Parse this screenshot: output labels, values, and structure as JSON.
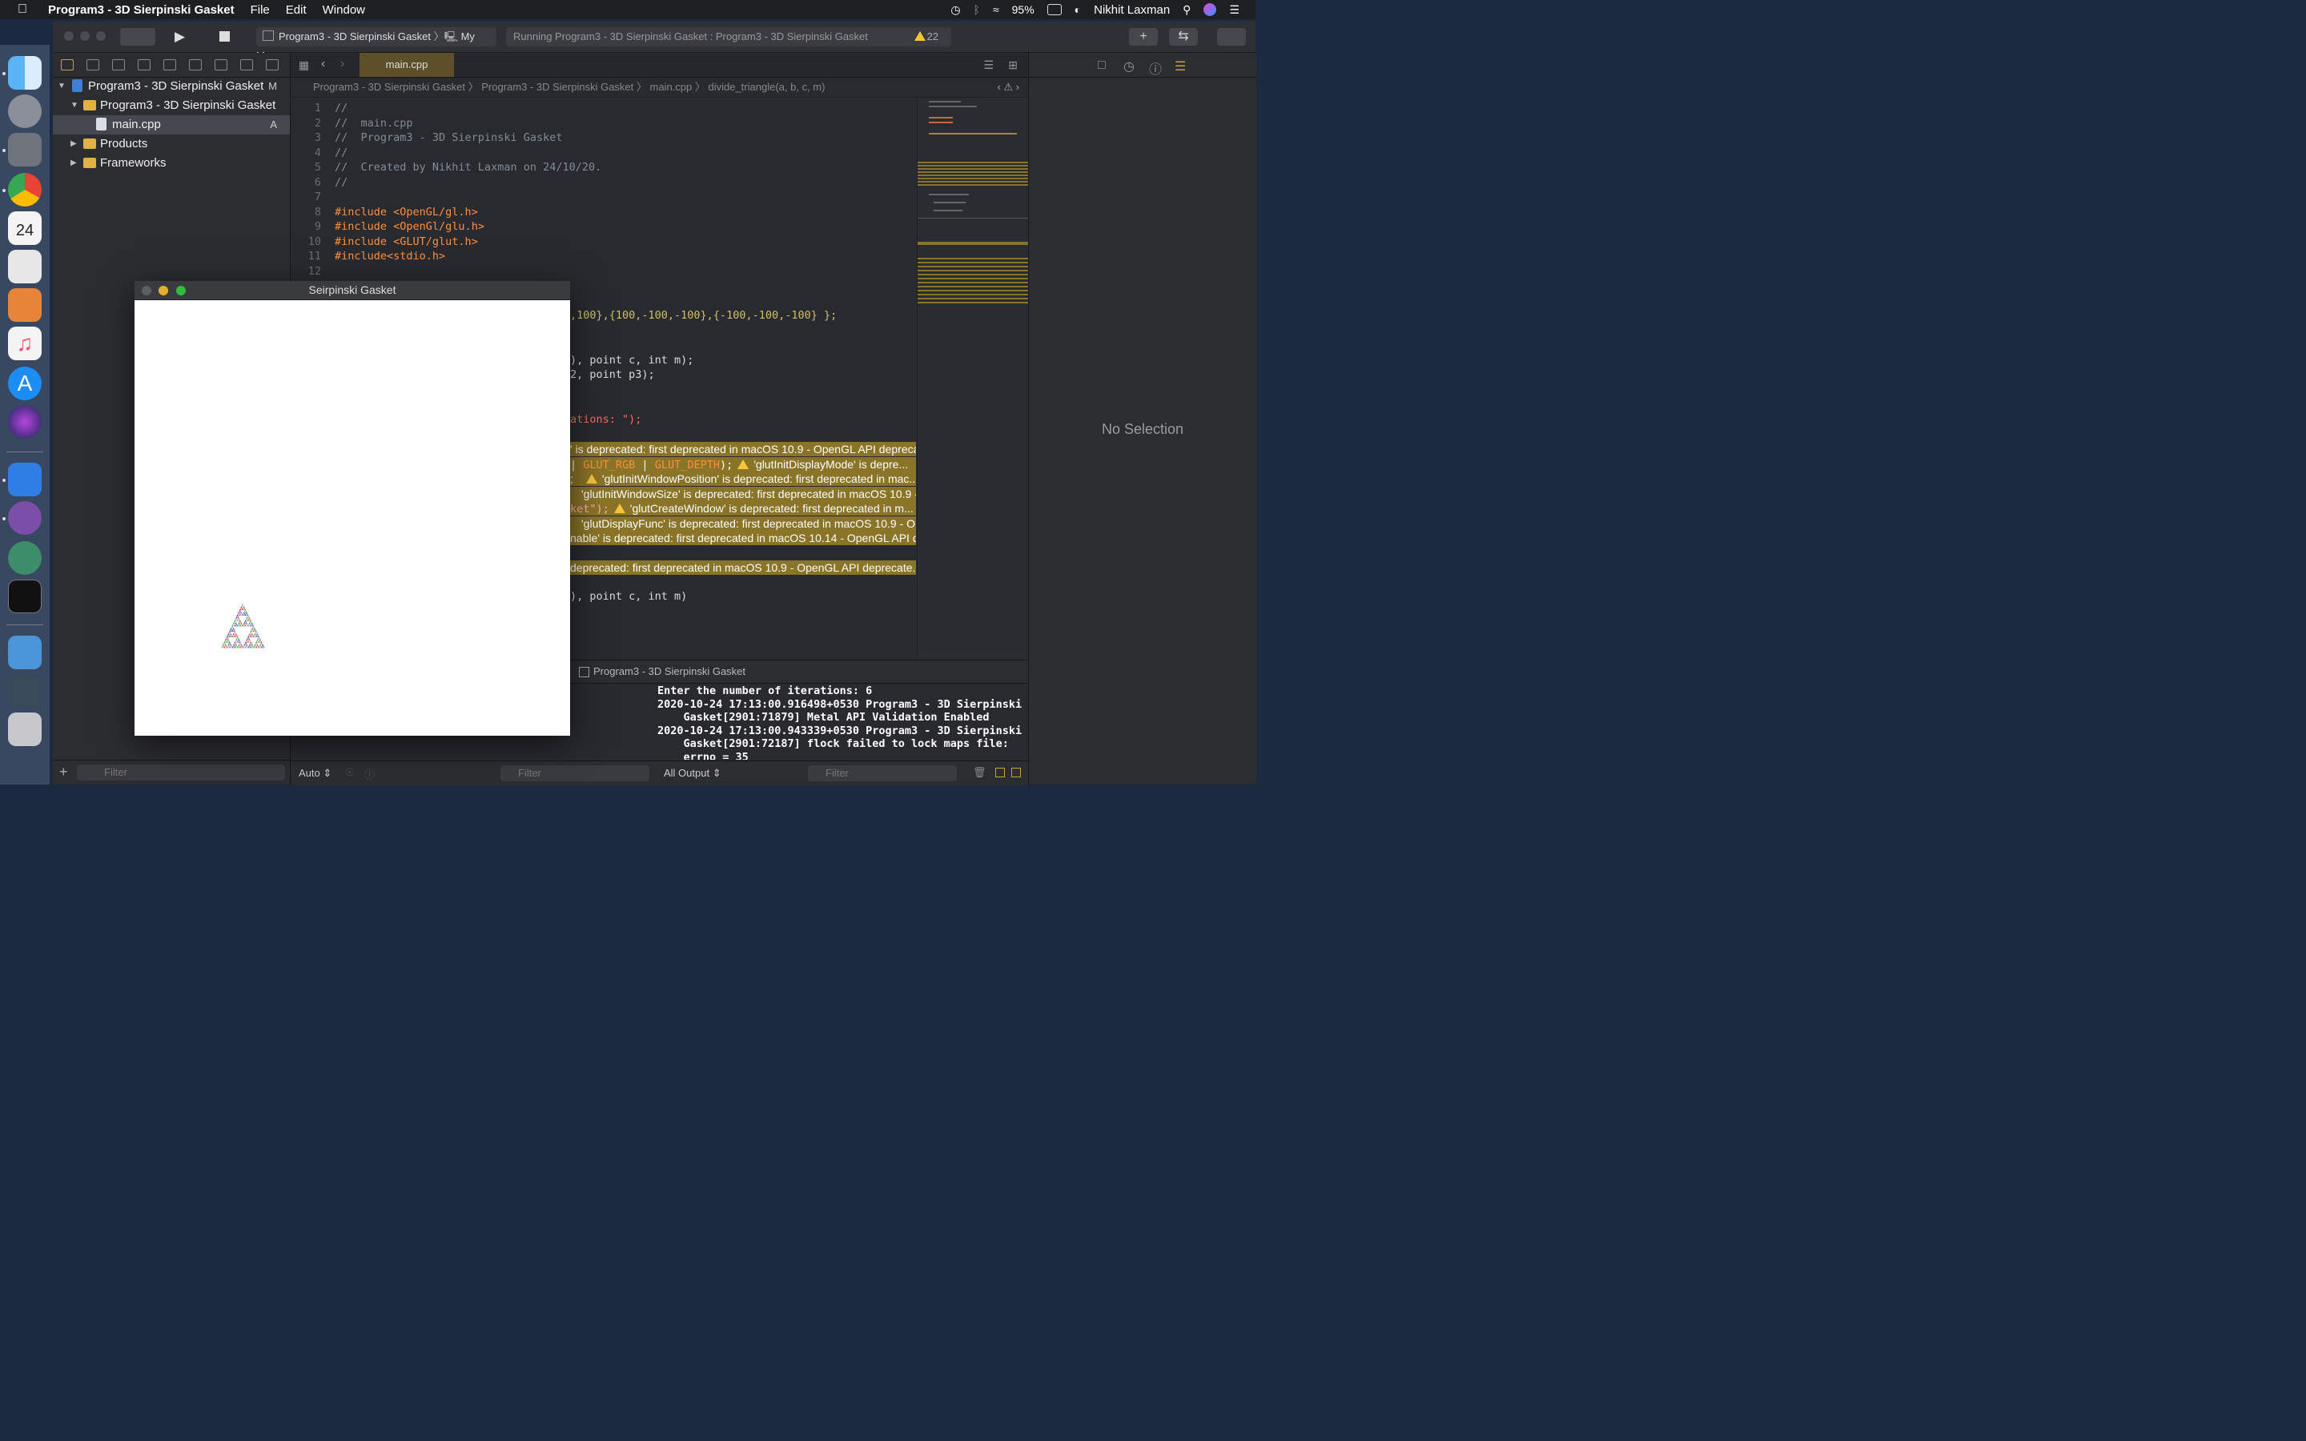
{
  "menubar": {
    "app_name": "Program3 - 3D Sierpinski Gasket",
    "menus": [
      "File",
      "Edit",
      "Window"
    ],
    "battery": "95%",
    "user": "Nikhit Laxman"
  },
  "toolbar": {
    "scheme": "Program3 - 3D Sierpinski Gasket",
    "destination": "My Mac",
    "status": "Running Program3 - 3D Sierpinski Gasket : Program3 - 3D Sierpinski Gasket",
    "warning_count": "22"
  },
  "navigator": {
    "project": "Program3 - 3D Sierpinski Gasket",
    "project_badge": "M",
    "group": "Program3 - 3D Sierpinski Gasket",
    "file": "main.cpp",
    "file_badge": "A",
    "products": "Products",
    "frameworks": "Frameworks",
    "filter_placeholder": "Filter"
  },
  "editor": {
    "tab": "main.cpp",
    "jumpbar": [
      "Program3 - 3D Sierpinski Gasket",
      "Program3 - 3D Sierpinski Gasket",
      "main.cpp",
      "divide_triangle(a, b, c, m)"
    ],
    "lines": {
      "l1": "//",
      "l2": "//  main.cpp",
      "l3": "//  Program3 - 3D Sierpinski Gasket",
      "l4": "//",
      "l5": "//  Created by Nikhit Laxman on 24/10/20.",
      "l6": "//",
      "l8a": "#include ",
      "l8b": "<OpenGL/gl.h>",
      "l9a": "#include ",
      "l9b": "<OpenGl/glu.h>",
      "l10a": "#include ",
      "l10b": "<GLUT/glut.h>",
      "l11a": "#include",
      "l11b": "<stdio.h>",
      "v1": ",100},{100,-100,-100},{-100,-100,-100} };",
      "v2": "), point c, int m);",
      "v3": "2, point p3);",
      "v4": "ations: \");",
      "v5": "), point c, int m)"
    },
    "warnings": {
      "w1": "' is deprecated: first deprecated in macOS 10.9 - OpenGL API depreca...",
      "w2a": "GLUT_RGB",
      "w2b": "GLUT_DEPTH",
      "w2c": "'glutInitDisplayMode' is depre...",
      "w3": "'glutInitWindowPosition' is deprecated: first deprecated in mac...",
      "w4": "'glutInitWindowSize' is deprecated: first deprecated in macOS 10.9 -...",
      "w5a": "ket\");",
      "w5b": "'glutCreateWindow' is deprecated: first deprecated in m...",
      "w6": "'glutDisplayFunc' is deprecated: first deprecated in macOS 10.9 - O...",
      "w7": "nable' is deprecated: first deprecated in macOS 10.14 - OpenGL API de...",
      "w8": " deprecated: first deprecated in macOS 10.9 - OpenGL API deprecate..."
    }
  },
  "debug": {
    "target": "Program3 - 3D Sierpinski Gasket",
    "console": "Enter the number of iterations: 6\n2020-10-24 17:13:00.916498+0530 Program3 - 3D Sierpinski\n    Gasket[2901:71879] Metal API Validation Enabled\n2020-10-24 17:13:00.943339+0530 Program3 - 3D Sierpinski\n    Gasket[2901:72187] flock failed to lock maps file:\n    errno = 35",
    "auto": "Auto",
    "filter_placeholder": "Filter",
    "output": "All Output",
    "filter2_placeholder": "Filter"
  },
  "inspector": {
    "empty": "No Selection"
  },
  "glut_window": {
    "title": "Seirpinski Gasket",
    "iterations": 6
  }
}
